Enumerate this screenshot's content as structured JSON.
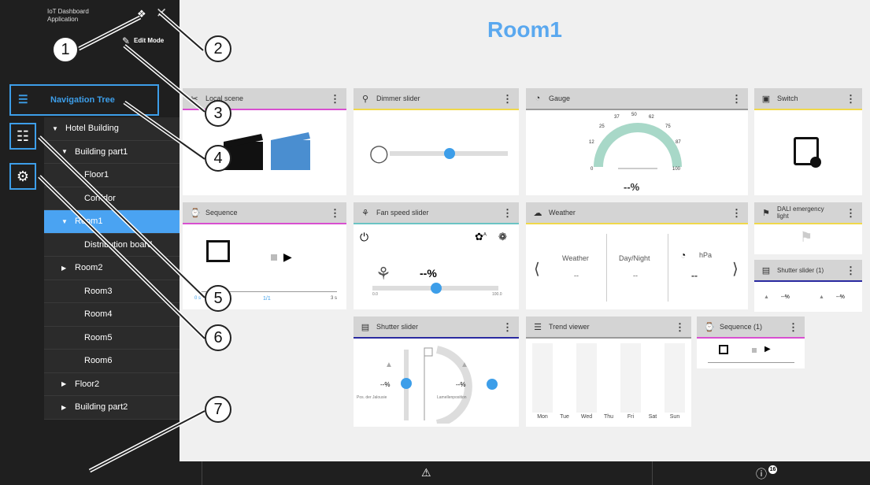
{
  "app": {
    "title_line1": "IoT Dashboard",
    "title_line2": "Application",
    "edit_mode": "Edit Mode",
    "page_title": "Room1"
  },
  "nav": {
    "header": "Navigation Tree",
    "items": [
      {
        "label": "Hotel Building",
        "indent": 0,
        "arrow": "down"
      },
      {
        "label": "Building part1",
        "indent": 1,
        "arrow": "down"
      },
      {
        "label": "Floor1",
        "indent": 2,
        "arrow": "none"
      },
      {
        "label": "Corridor",
        "indent": 2,
        "arrow": "none"
      },
      {
        "label": "Room1",
        "indent": 1,
        "arrow": "down",
        "selected": true
      },
      {
        "label": "Distribution board",
        "indent": 2,
        "arrow": "none"
      },
      {
        "label": "Room2",
        "indent": 1,
        "arrow": "right"
      },
      {
        "label": "Room3",
        "indent": 2,
        "arrow": "none"
      },
      {
        "label": "Room4",
        "indent": 2,
        "arrow": "none"
      },
      {
        "label": "Room5",
        "indent": 2,
        "arrow": "none"
      },
      {
        "label": "Room6",
        "indent": 2,
        "arrow": "none"
      },
      {
        "label": "Floor2",
        "indent": 1,
        "arrow": "right"
      },
      {
        "label": "Building part2",
        "indent": 1,
        "arrow": "right"
      }
    ]
  },
  "tiles": {
    "local_scene": {
      "title": "Local scene"
    },
    "dimmer": {
      "title": "Dimmer slider",
      "value": 0.5
    },
    "gauge": {
      "title": "Gauge",
      "ticks": [
        "0",
        "12",
        "25",
        "37",
        "50",
        "62",
        "75",
        "87",
        "100"
      ],
      "value": "--%"
    },
    "switch": {
      "title": "Switch"
    },
    "sequence": {
      "title": "Sequence",
      "start": "0 s",
      "count": "1/1",
      "end": "3 s"
    },
    "fan": {
      "title": "Fan speed slider",
      "value": "--%",
      "min": "0.0",
      "max": "100.0",
      "fan_a": "A"
    },
    "weather": {
      "title": "Weather",
      "col1": "Weather",
      "col2": "Day/Night",
      "col3": "hPa",
      "val1": "--",
      "val2": "--",
      "val3": "--"
    },
    "dali": {
      "title": "DALI emergency light"
    },
    "shutter_small": {
      "title": "Shutter slider (1)",
      "val1": "--%",
      "val2": "--%"
    },
    "shutter": {
      "title": "Shutter slider",
      "val1": "--%",
      "label1": "Pos. der Jalousie",
      "val2": "--%",
      "label2": "Lamellenposition"
    },
    "trend": {
      "title": "Trend viewer",
      "days": [
        "Mon",
        "Tue",
        "Wed",
        "Thu",
        "Fri",
        "Sat",
        "Sun"
      ]
    },
    "sequence2": {
      "title": "Sequence (1)"
    }
  },
  "footer": {
    "badge": "16"
  },
  "callouts": [
    "1",
    "2",
    "3",
    "4",
    "5",
    "6",
    "7"
  ],
  "colors": {
    "accent": "#3d9ee9",
    "selected": "#4aa3f2",
    "title": "#5aa8ef",
    "gauge": "#a8d8c8"
  }
}
